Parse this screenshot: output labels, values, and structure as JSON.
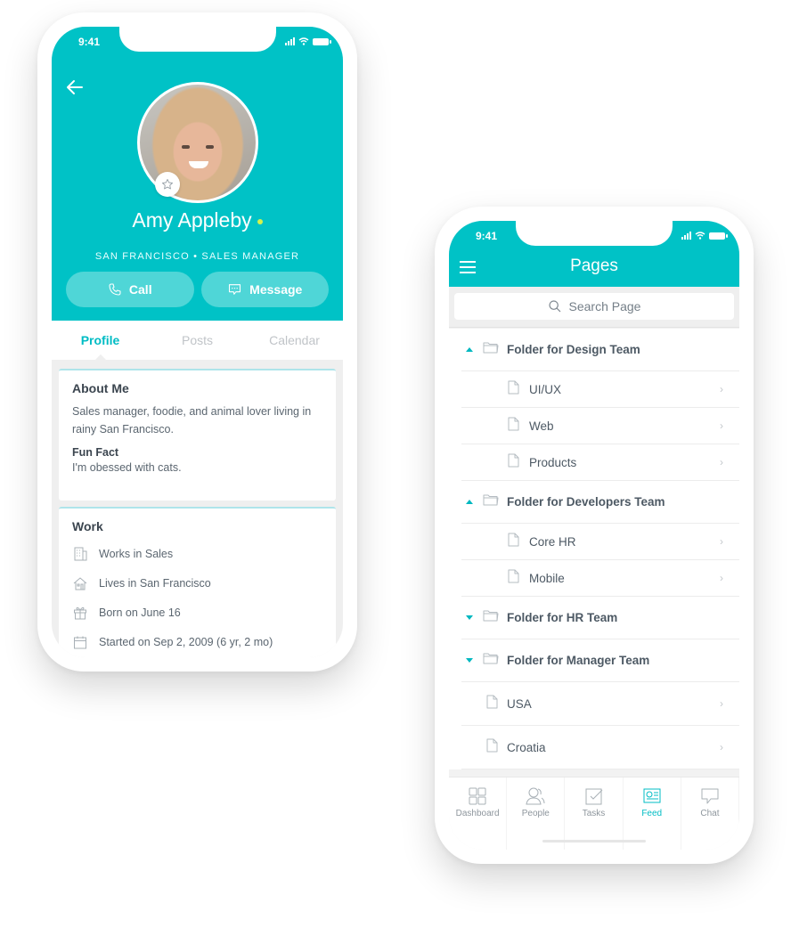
{
  "colors": {
    "brand": "#00c2c6",
    "accent_text": "#00bcc4",
    "online": "#d4f24c"
  },
  "status_bar": {
    "time": "9:41"
  },
  "profile_screen": {
    "back_icon": "arrow-left-icon",
    "name": "Amy Appleby",
    "online": true,
    "subtitle": "SAN FRANCISCO • SALES MANAGER",
    "favorite_icon": "star-outline-icon",
    "actions": [
      {
        "label": "Call",
        "icon": "phone-icon"
      },
      {
        "label": "Message",
        "icon": "chat-bubble-icon"
      }
    ],
    "tabs": [
      {
        "label": "Profile",
        "active": true
      },
      {
        "label": "Posts",
        "active": false
      },
      {
        "label": "Calendar",
        "active": false
      }
    ],
    "about": {
      "title": "About Me",
      "text": "Sales manager, foodie, and animal lover living in rainy San Francisco.",
      "fun_fact_title": "Fun Fact",
      "fun_fact": "I'm obessed with cats."
    },
    "work": {
      "title": "Work",
      "items": [
        {
          "icon": "building-icon",
          "text": "Works in Sales"
        },
        {
          "icon": "home-icon",
          "text": "Lives in San Francisco"
        },
        {
          "icon": "gift-icon",
          "text": "Born on June 16"
        },
        {
          "icon": "calendar-icon",
          "text": "Started on Sep 2, 2009 (6 yr, 2 mo)"
        }
      ]
    }
  },
  "pages_screen": {
    "title": "Pages",
    "menu_icon": "hamburger-icon",
    "search_placeholder": "Search Page",
    "tree": [
      {
        "type": "folder",
        "label": "Folder for Design Team",
        "expanded": true
      },
      {
        "type": "page",
        "label": "UI/UX",
        "level": 1
      },
      {
        "type": "page",
        "label": "Web",
        "level": 1
      },
      {
        "type": "page",
        "label": "Products",
        "level": 1
      },
      {
        "type": "folder",
        "label": "Folder for Developers Team",
        "expanded": true
      },
      {
        "type": "page",
        "label": "Core HR",
        "level": 1
      },
      {
        "type": "page",
        "label": "Mobile",
        "level": 1
      },
      {
        "type": "folder",
        "label": "Folder for HR Team",
        "expanded": false
      },
      {
        "type": "folder",
        "label": "Folder for Manager Team",
        "expanded": false
      },
      {
        "type": "page",
        "label": "USA",
        "level": 0
      },
      {
        "type": "page",
        "label": "Croatia",
        "level": 0
      }
    ],
    "bottom_nav": [
      {
        "label": "Dashboard",
        "icon": "dashboard-icon",
        "active": false
      },
      {
        "label": "People",
        "icon": "people-icon",
        "active": false
      },
      {
        "label": "Tasks",
        "icon": "tasks-icon",
        "active": false
      },
      {
        "label": "Feed",
        "icon": "feed-icon",
        "active": true
      },
      {
        "label": "Chat",
        "icon": "chat-icon",
        "active": false
      }
    ]
  }
}
